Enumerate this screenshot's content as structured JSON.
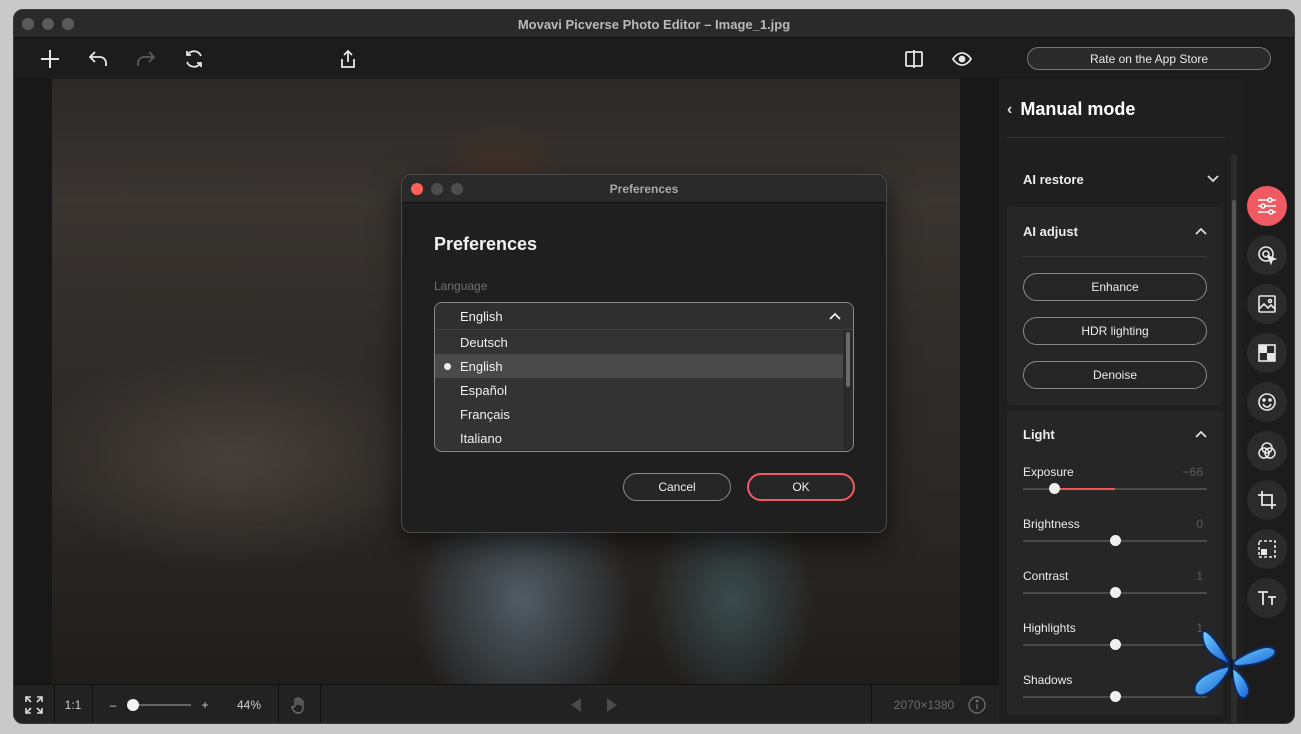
{
  "window": {
    "title": "Movavi Picverse Photo Editor – Image_1.jpg"
  },
  "toolbar": {
    "rate_label": "Rate on the App Store"
  },
  "bottombar": {
    "one_to_one": "1:1",
    "zoom_minus": "–",
    "zoom_plus": "+",
    "zoom_level": "44%",
    "zoom_fraction": 0.1,
    "dimensions": "2070×1380"
  },
  "panel": {
    "header": "Manual mode",
    "ai_restore": "AI restore",
    "ai_adjust": "AI adjust",
    "buttons": [
      "Enhance",
      "HDR lighting",
      "Denoise"
    ],
    "light": "Light",
    "sliders": [
      {
        "label": "Exposure",
        "value": "−66",
        "numeric": -66
      },
      {
        "label": "Brightness",
        "value": "0",
        "numeric": 0
      },
      {
        "label": "Contrast",
        "value": "1",
        "numeric": 1
      },
      {
        "label": "Highlights",
        "value": "1",
        "numeric": 1
      },
      {
        "label": "Shadows",
        "value": "",
        "numeric": 0
      }
    ]
  },
  "iconbar": [
    "adjust-icon",
    "retouch-icon",
    "background-icon",
    "mask-icon",
    "face-icon",
    "color-icon",
    "crop-icon",
    "select-icon",
    "text-icon"
  ],
  "dialog": {
    "window_title": "Preferences",
    "heading": "Preferences",
    "language_label": "Language",
    "selected_language": "English",
    "options": [
      "Deutsch",
      "English",
      "Español",
      "Français",
      "Italiano"
    ],
    "highlighted_option": "English",
    "cancel_label": "Cancel",
    "ok_label": "OK"
  },
  "colors": {
    "accent": "#f05a62",
    "close_button": "#fe5f57"
  }
}
